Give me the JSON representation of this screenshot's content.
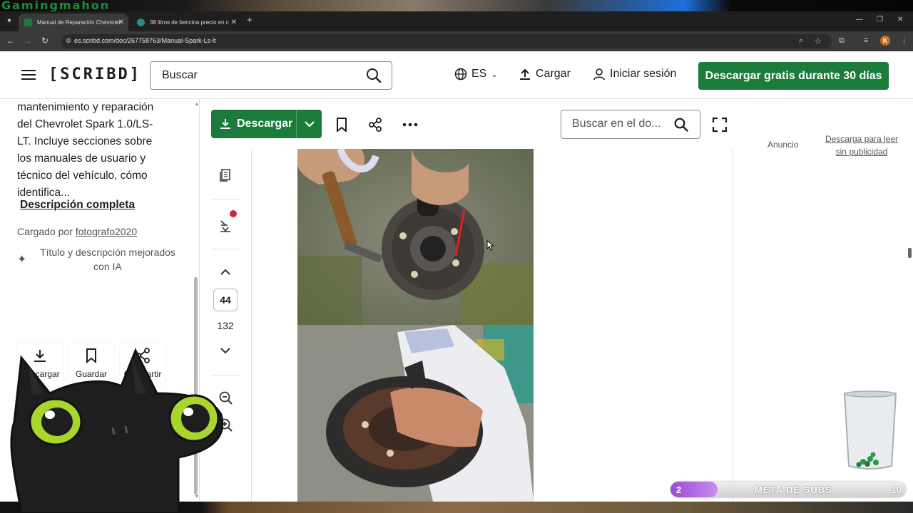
{
  "stream": {
    "logo_text": "Gamingmahon"
  },
  "browser": {
    "tabs": [
      {
        "title": "Manual de Reparación Chevrolet",
        "favicon_color": "#1a7b3a"
      },
      {
        "title": "38 litros de bencina precio en c",
        "favicon_color": "#2a8a8a"
      }
    ],
    "url": "es.scribd.com/doc/267758763/Manual-Spark-Ls-lt",
    "profile_initial": "K"
  },
  "header": {
    "logo": "[SCRIBD]",
    "search_placeholder": "Buscar",
    "language": "ES",
    "upload": "Cargar",
    "login": "Iniciar sesión",
    "cta": "Descargar gratis durante 30 días"
  },
  "sidebar": {
    "description": "mantenimiento y reparación del Chevrolet Spark 1.0/LS-LT. Incluye secciones sobre los manuales de usuario y técnico del vehículo, cómo identifica...",
    "full_description_link": "Descripción completa",
    "uploaded_by_label": "Cargado por",
    "uploader": "fotografo2020",
    "ai_note": "Título y descripción mejorados con IA",
    "actions": [
      {
        "label": "Descargar",
        "icon": "download-icon"
      },
      {
        "label": "Guardar",
        "icon": "bookmark-icon"
      },
      {
        "label": "Compartir",
        "icon": "share-icon"
      }
    ]
  },
  "doc_toolbar": {
    "download": "Descargar",
    "search_placeholder": "Buscar en el do..."
  },
  "pager": {
    "current_page": "44",
    "total_pages": "132"
  },
  "ad": {
    "label": "Anuncio",
    "link": "Descarga para leer sin publicidad"
  },
  "overlay": {
    "subs_current": "2",
    "subs_title": "META DE SUBS",
    "subs_goal": "10",
    "subs_progress": 0.2
  },
  "colors": {
    "brand_green": "#1a7b3a",
    "notification_red": "#d4213d",
    "subs_purple": "#9b4ad6"
  }
}
